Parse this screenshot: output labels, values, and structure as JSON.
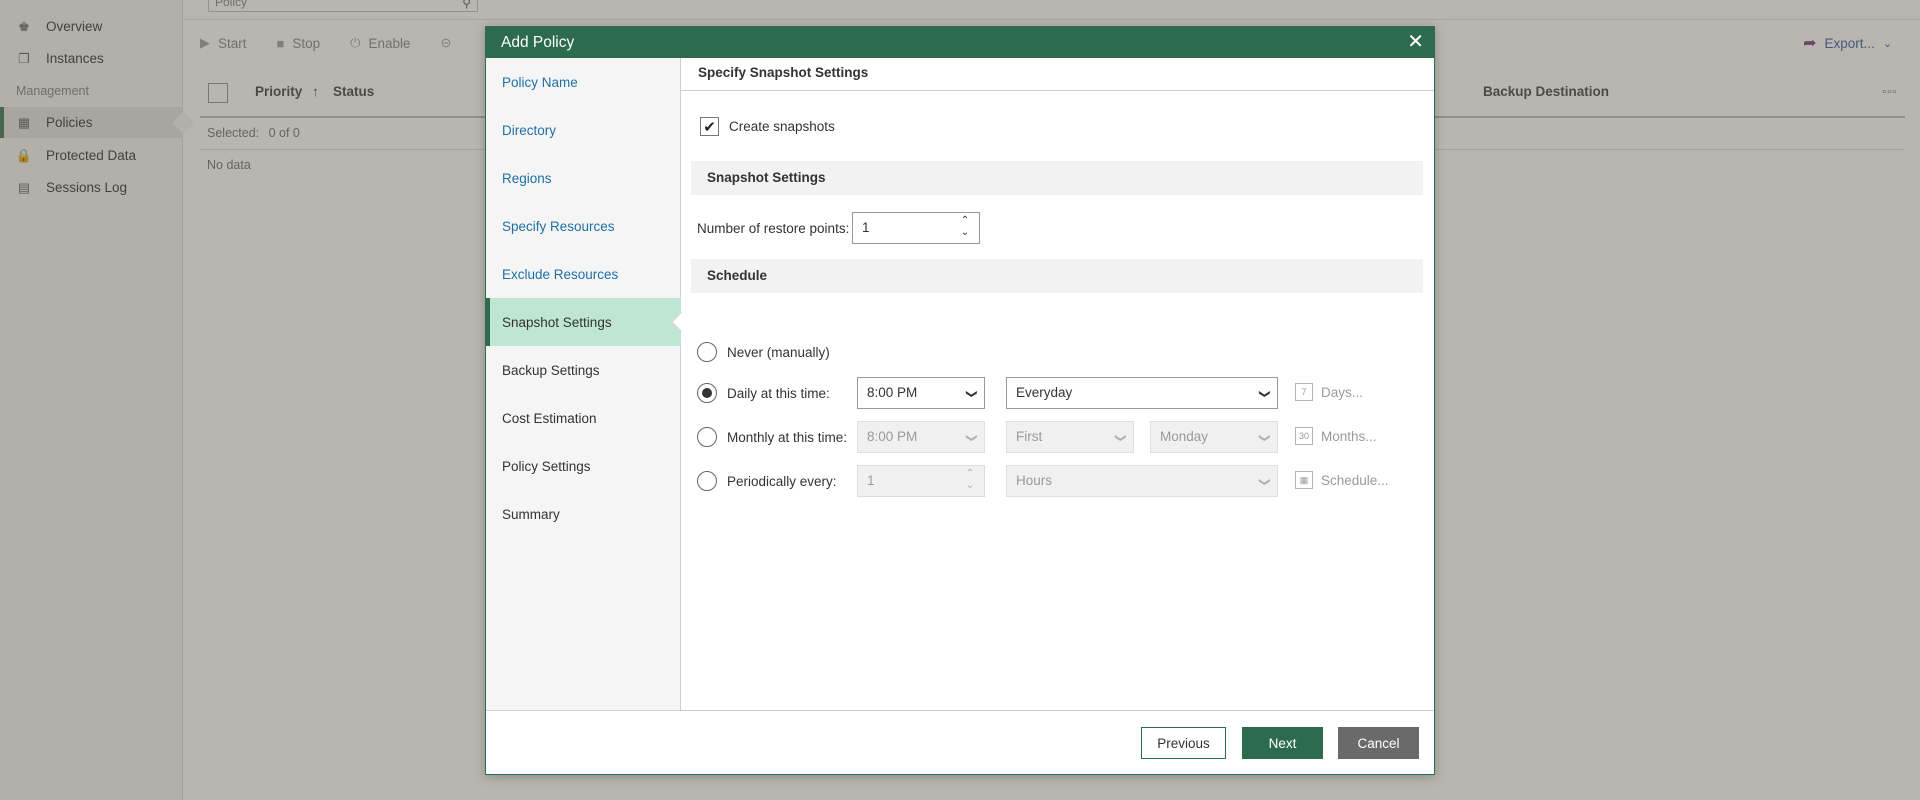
{
  "sidebar": {
    "items": [
      {
        "label": "Overview",
        "icon": "binoculars-icon"
      },
      {
        "label": "Instances",
        "icon": "instances-icon"
      },
      {
        "label": "Policies",
        "icon": "policy-icon"
      },
      {
        "label": "Protected Data",
        "icon": "lock-icon"
      },
      {
        "label": "Sessions Log",
        "icon": "log-icon"
      }
    ],
    "section_management": "Management"
  },
  "search": {
    "value": "Policy"
  },
  "toolbar": {
    "start": "Start",
    "stop": "Stop",
    "enable": "Enable",
    "export": "Export..."
  },
  "grid": {
    "columns": {
      "priority": "Priority",
      "status": "Status",
      "backup_destination": "Backup Destination"
    },
    "selected_label": "Selected:",
    "selected_value": "0 of 0",
    "empty": "No data"
  },
  "modal": {
    "title": "Add Policy",
    "steps": [
      {
        "label": "Policy Name"
      },
      {
        "label": "Directory"
      },
      {
        "label": "Regions"
      },
      {
        "label": "Specify Resources"
      },
      {
        "label": "Exclude Resources"
      },
      {
        "label": "Snapshot Settings"
      },
      {
        "label": "Backup Settings"
      },
      {
        "label": "Cost Estimation"
      },
      {
        "label": "Policy Settings"
      },
      {
        "label": "Summary"
      }
    ],
    "active_step": "Snapshot Settings",
    "content": {
      "title": "Specify Snapshot Settings",
      "create_snapshots_label": "Create snapshots",
      "create_snapshots_checked": true,
      "snapshot_section": "Snapshot Settings",
      "restore_points_label": "Number of restore points:",
      "restore_points_value": "1",
      "schedule_section": "Schedule",
      "schedule": {
        "never_label": "Never (manually)",
        "daily_label": "Daily at this time:",
        "daily_time": "8:00 PM",
        "daily_days": "Everyday",
        "days_link": "Days...",
        "monthly_label": "Monthly at this time:",
        "monthly_time": "8:00 PM",
        "monthly_week": "First",
        "monthly_day": "Monday",
        "months_link": "Months...",
        "periodic_label": "Periodically every:",
        "periodic_value": "1",
        "periodic_unit": "Hours",
        "schedule_link": "Schedule...",
        "selected_option": "daily"
      }
    },
    "buttons": {
      "previous": "Previous",
      "next": "Next",
      "cancel": "Cancel"
    }
  },
  "colors": {
    "header_green": "#2d6b4f",
    "active_step_bg": "#bfe6d2",
    "link_blue": "#1f6fa6",
    "cancel_gray": "#6a6a6a"
  }
}
